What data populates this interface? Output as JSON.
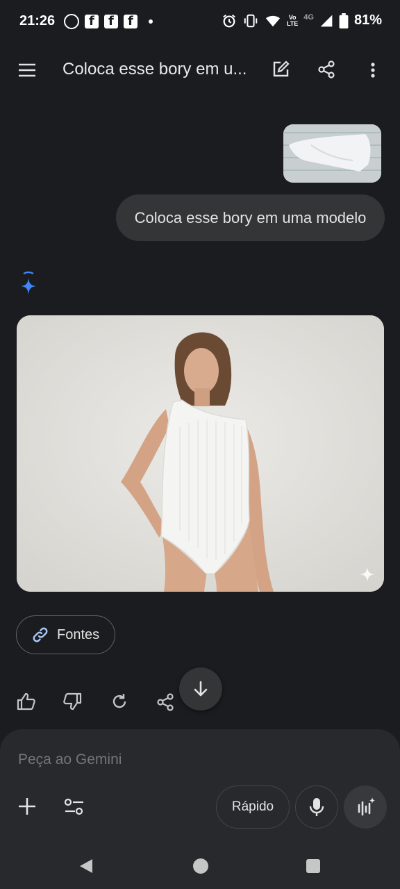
{
  "status_bar": {
    "time": "21:26",
    "battery": "81%",
    "network": "4G",
    "icons": [
      "whatsapp-icon",
      "facebook-icon",
      "facebook-icon",
      "facebook-icon",
      "dot-icon",
      "alarm-icon",
      "vibrate-icon",
      "wifi-icon",
      "volte-icon",
      "signal-icon",
      "battery-icon"
    ]
  },
  "top_bar": {
    "title": "Coloca esse bory em u...",
    "icons": [
      "menu-icon",
      "edit-icon",
      "share-icon",
      "more-vert-icon"
    ]
  },
  "conversation": {
    "user_message": "Coloca esse bory em uma modelo",
    "sources_label": "Fontes",
    "actions": [
      "thumbs-up-icon",
      "thumbs-down-icon",
      "regenerate-icon",
      "share-icon"
    ]
  },
  "input": {
    "placeholder": "Peça ao Gemini",
    "mode_label": "Rápido"
  },
  "colors": {
    "background": "#1b1c1f",
    "bubble": "#333537",
    "panel": "#27292c",
    "accent": "#4285f4",
    "link_icon": "#a8c7fa"
  }
}
